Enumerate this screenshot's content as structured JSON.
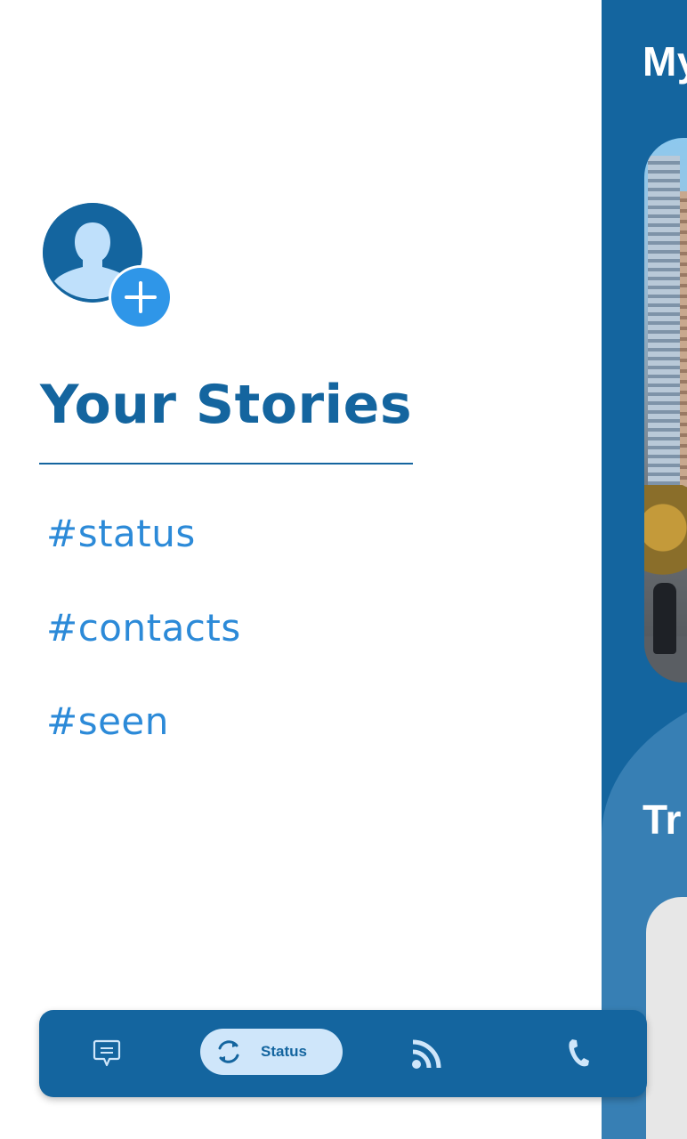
{
  "page": {
    "title": "Your Stories",
    "tags": [
      "#status",
      "#contacts",
      "#seen"
    ]
  },
  "avatar": {
    "icon": "user-silhouette-icon",
    "add_icon": "plus-icon"
  },
  "right_panel": {
    "title_top_partial": "My",
    "title_bottom_partial": "Tr"
  },
  "bottom_nav": {
    "items": [
      {
        "icon": "chat-bubble-icon",
        "label": ""
      },
      {
        "icon": "refresh-icon",
        "label": "Status",
        "active": true
      },
      {
        "icon": "rss-feed-icon",
        "label": ""
      },
      {
        "icon": "phone-icon",
        "label": ""
      }
    ]
  },
  "colors": {
    "primary": "#14659f",
    "accent": "#2f96e8",
    "tag_text": "#2c8ad8",
    "active_pill": "#cfe6fa",
    "panel_curve": "#377fb4"
  }
}
